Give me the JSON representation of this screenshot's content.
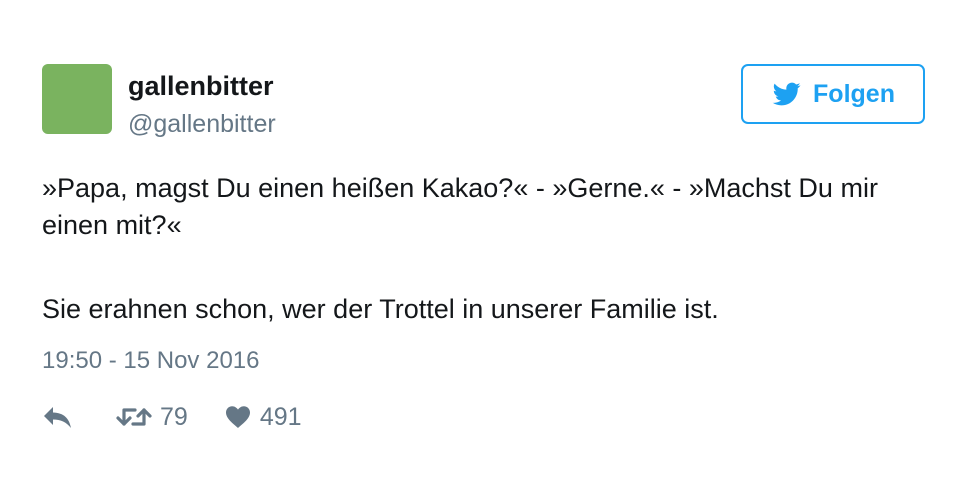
{
  "user": {
    "display_name": "gallenbitter",
    "handle": "@gallenbitter",
    "avatar_color": "#7ab35f"
  },
  "follow_button": {
    "label": "Folgen",
    "icon": "twitter-bird-icon",
    "accent_color": "#1da1f2"
  },
  "tweet": {
    "line1": "»Papa, magst Du einen heißen Kakao?« - »Gerne.« - »Machst Du mir einen mit?«",
    "line2": "Sie erahnen schon, wer der Trottel in unserer Familie ist.",
    "timestamp": "19:50 - 15 Nov 2016"
  },
  "actions": {
    "reply_icon": "reply-icon",
    "retweet_icon": "retweet-icon",
    "retweet_count": "79",
    "like_icon": "heart-icon",
    "like_count": "491"
  }
}
